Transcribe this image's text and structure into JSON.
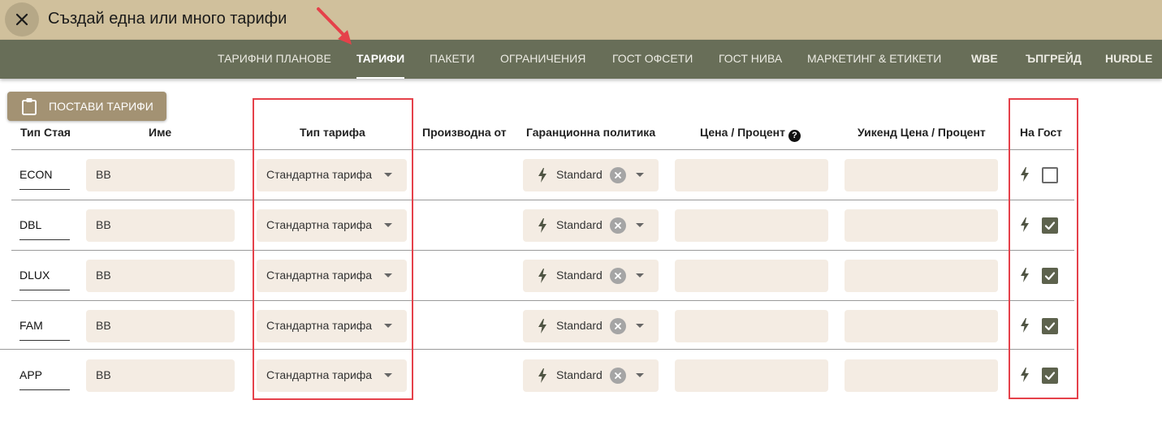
{
  "window": {
    "title": "Създай една или много тарифи"
  },
  "nav": {
    "tabs": [
      {
        "label": "ТАРИФНИ ПЛАНОВЕ",
        "active": false
      },
      {
        "label": "ТАРИФИ",
        "active": true
      },
      {
        "label": "ПАКЕТИ",
        "active": false
      },
      {
        "label": "ОГРАНИЧЕНИЯ",
        "active": false
      },
      {
        "label": "ГОСТ ОФСЕТИ",
        "active": false
      },
      {
        "label": "ГОСТ НИВА",
        "active": false
      },
      {
        "label": "МАРКЕТИНГ & ЕТИКЕТИ",
        "active": false
      },
      {
        "label": "WBE",
        "active": false
      },
      {
        "label": "ЪПГРЕЙД",
        "active": false
      },
      {
        "label": "HURDLE",
        "active": false
      }
    ]
  },
  "toolbar": {
    "apply_label": "ПОСТАВИ ТАРИФИ",
    "apply_icon": "clipboard-icon"
  },
  "table": {
    "headers": {
      "room_type": "Тип Стая",
      "name": "Име",
      "rate_type": "Тип тарифа",
      "derived_from": "Производна от",
      "guarantee_policy": "Гаранционна политика",
      "price": "Цена / Процент",
      "weekend_price": "Уикенд Цена / Процент",
      "on_guest": "На Гост"
    },
    "rows": [
      {
        "room_type": "ECON",
        "name": "BB",
        "rate_type": "Стандартна тарифа",
        "derived_from": "",
        "policy": "Standard",
        "price": "",
        "weekend_price": "",
        "on_guest": false
      },
      {
        "room_type": "DBL",
        "name": "BB",
        "rate_type": "Стандартна тарифа",
        "derived_from": "",
        "policy": "Standard",
        "price": "",
        "weekend_price": "",
        "on_guest": true
      },
      {
        "room_type": "DLUX",
        "name": "BB",
        "rate_type": "Стандартна тарифа",
        "derived_from": "",
        "policy": "Standard",
        "price": "",
        "weekend_price": "",
        "on_guest": true
      },
      {
        "room_type": "FAM",
        "name": "BB",
        "rate_type": "Стандартна тарифа",
        "derived_from": "",
        "policy": "Standard",
        "price": "",
        "weekend_price": "",
        "on_guest": true
      },
      {
        "room_type": "APP",
        "name": "BB",
        "rate_type": "Стандартна тарифа",
        "derived_from": "",
        "policy": "Standard",
        "price": "",
        "weekend_price": "",
        "on_guest": true
      }
    ]
  },
  "colors": {
    "titlebar": "#d0c09c",
    "navbar": "#686e58",
    "field_bg": "#f4ece3",
    "highlight": "#e5414a",
    "checkbox_checked": "#5d624d"
  }
}
